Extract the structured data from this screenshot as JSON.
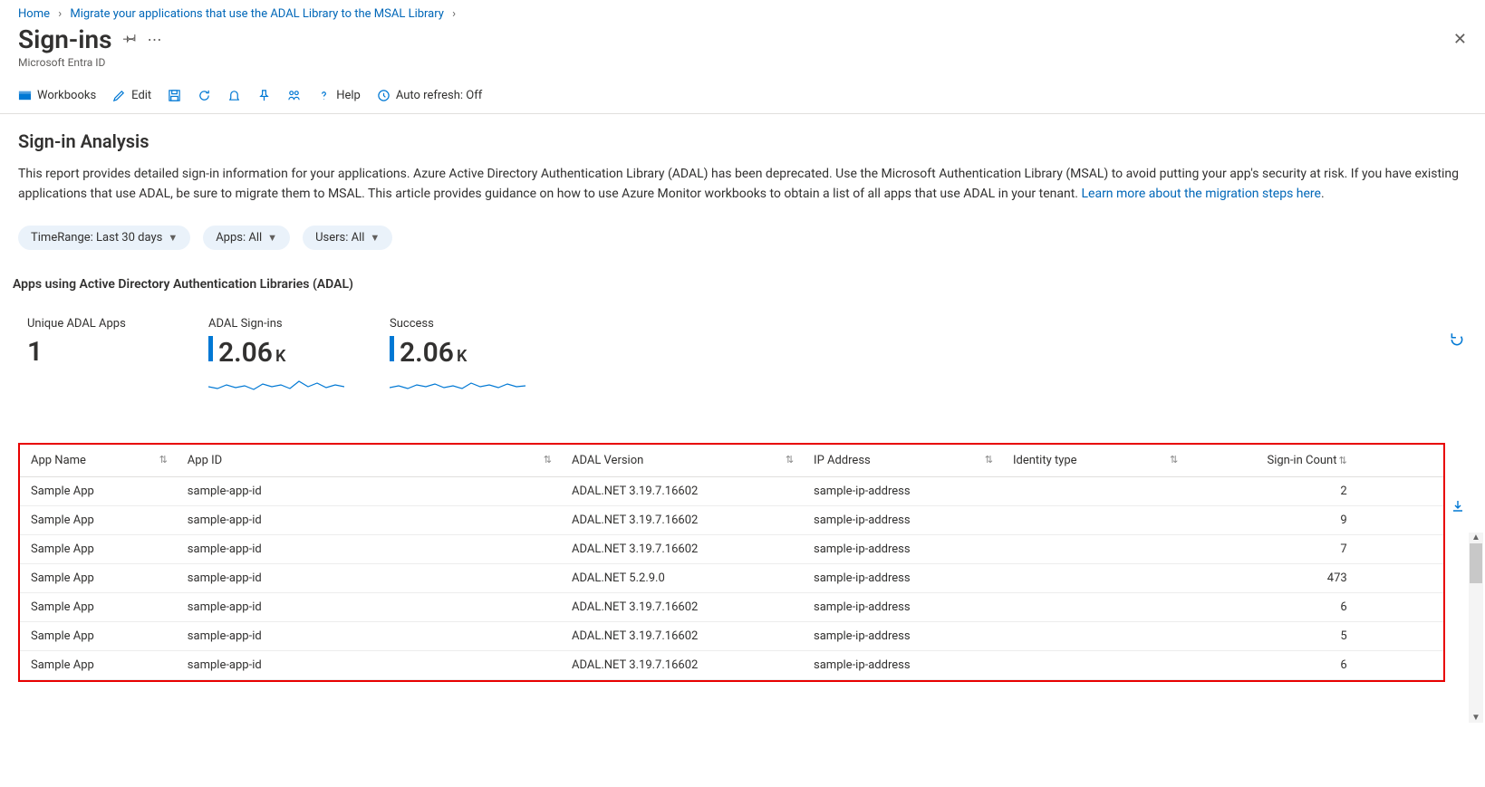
{
  "breadcrumb": {
    "home": "Home",
    "mid": "Migrate your applications that use the ADAL Library to the MSAL Library"
  },
  "header": {
    "title": "Sign-ins",
    "subtitle": "Microsoft Entra ID"
  },
  "toolbar": {
    "workbooks": "Workbooks",
    "edit": "Edit",
    "help": "Help",
    "autorefresh": "Auto refresh: Off"
  },
  "section": {
    "title": "Sign-in Analysis",
    "desc_before_link": "This report provides detailed sign-in information for your applications. Azure Active Directory Authentication Library (ADAL) has been deprecated. Use the Microsoft Authentication Library (MSAL) to avoid putting your app's security at risk. If you have existing applications that use ADAL, be sure to migrate them to MSAL. This article provides guidance on how to use Azure Monitor workbooks to obtain a list of all apps that use ADAL in your tenant. ",
    "link_text": "Learn more about the migration steps here",
    "period": "."
  },
  "filters": {
    "timerange": "TimeRange: Last 30 days",
    "apps": "Apps: All",
    "users": "Users: All"
  },
  "subheading": "Apps using Active Directory Authentication Libraries (ADAL)",
  "metrics": {
    "unique_label": "Unique ADAL Apps",
    "unique_value": "1",
    "signins_label": "ADAL Sign-ins",
    "signins_value": "2.06",
    "signins_unit": "K",
    "success_label": "Success",
    "success_value": "2.06",
    "success_unit": "K"
  },
  "table": {
    "columns": {
      "app_name": "App Name",
      "app_id": "App ID",
      "adal_version": "ADAL Version",
      "ip": "IP Address",
      "identity": "Identity type",
      "count": "Sign-in Count"
    },
    "rows": [
      {
        "app_name": "Sample App",
        "app_id": "sample-app-id",
        "adal_version": "ADAL.NET 3.19.7.16602",
        "ip": "sample-ip-address",
        "identity": "",
        "count": "2"
      },
      {
        "app_name": "Sample App",
        "app_id": "sample-app-id",
        "adal_version": "ADAL.NET 3.19.7.16602",
        "ip": "sample-ip-address",
        "identity": "",
        "count": "9"
      },
      {
        "app_name": "Sample App",
        "app_id": "sample-app-id",
        "adal_version": "ADAL.NET 3.19.7.16602",
        "ip": "sample-ip-address",
        "identity": "",
        "count": "7"
      },
      {
        "app_name": "Sample App",
        "app_id": "sample-app-id",
        "adal_version": "ADAL.NET 5.2.9.0",
        "ip": "sample-ip-address",
        "identity": "",
        "count": "473"
      },
      {
        "app_name": "Sample App",
        "app_id": "sample-app-id",
        "adal_version": "ADAL.NET 3.19.7.16602",
        "ip": "sample-ip-address",
        "identity": "",
        "count": "6"
      },
      {
        "app_name": "Sample App",
        "app_id": "sample-app-id",
        "adal_version": "ADAL.NET 3.19.7.16602",
        "ip": "sample-ip-address",
        "identity": "",
        "count": "5"
      },
      {
        "app_name": "Sample App",
        "app_id": "sample-app-id",
        "adal_version": "ADAL.NET 3.19.7.16602",
        "ip": "sample-ip-address",
        "identity": "",
        "count": "6"
      }
    ]
  }
}
